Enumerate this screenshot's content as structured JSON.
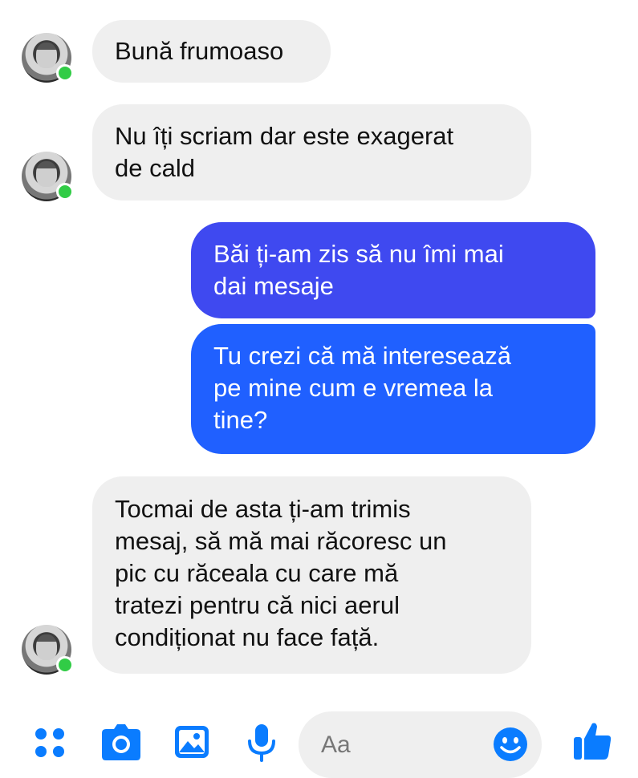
{
  "messages": [
    {
      "sender": "other",
      "text": "Bună frumoaso",
      "online": true
    },
    {
      "sender": "other",
      "text": "Nu îți scriam dar este exagerat\nde cald",
      "online": true
    },
    {
      "sender": "me",
      "text": "Băi ți-am zis să nu îmi mai\ndai mesaje"
    },
    {
      "sender": "me",
      "text": "Tu crezi că mă interesează\npe mine cum e vremea la\ntine?"
    },
    {
      "sender": "other",
      "text": "Tocmai de asta ți-am trimis\nmesaj, să mă mai răcoresc un\npic cu răceala cu care mă\ntratezi pentru că nici aerul\ncondiționat nu face față.",
      "online": true
    }
  ],
  "composer": {
    "placeholder": "Aa"
  },
  "toolbar": {
    "icons": [
      "apps-icon",
      "camera-icon",
      "gallery-icon",
      "microphone-icon",
      "emoji-icon",
      "thumbs-up-icon"
    ]
  },
  "colors": {
    "accent": "#0a7cff",
    "outgoing_top": "#3c4bf2",
    "outgoing_bottom": "#1f63ff",
    "incoming": "#efefef",
    "online": "#31cc46"
  }
}
